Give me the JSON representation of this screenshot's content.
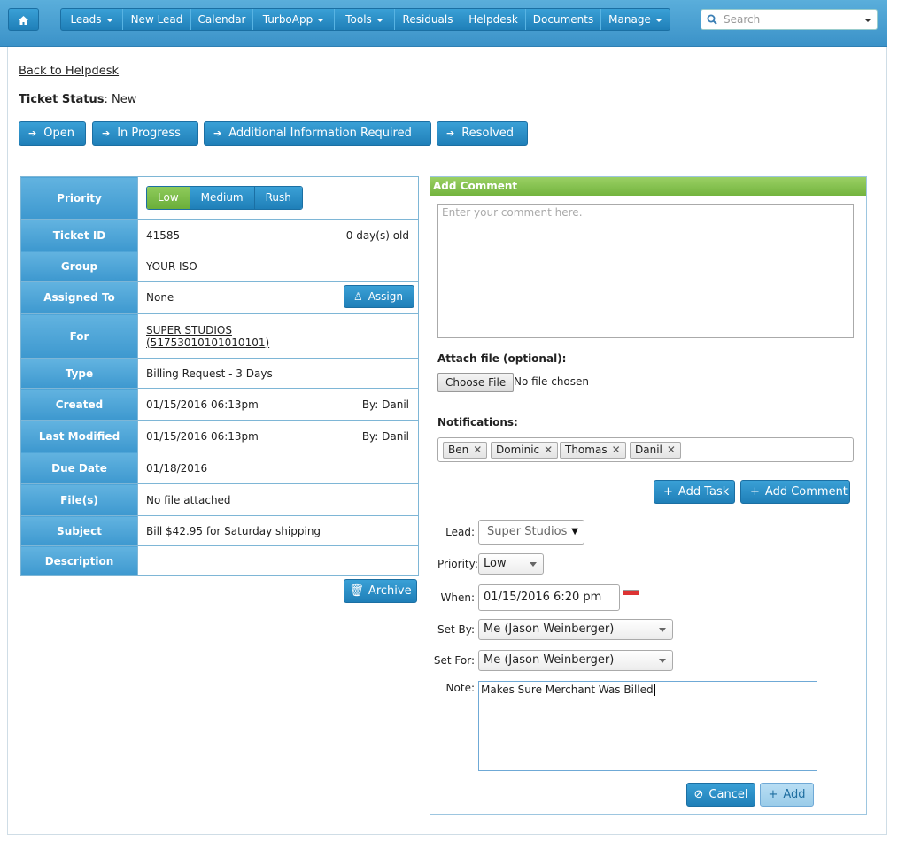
{
  "nav": {
    "home_icon": "home-icon",
    "items": [
      {
        "label": "Leads",
        "dropdown": true
      },
      {
        "label": "New Lead",
        "dropdown": false
      },
      {
        "label": "Calendar",
        "dropdown": false
      },
      {
        "label": "TurboApp",
        "dropdown": true
      },
      {
        "label": "Tools",
        "dropdown": true
      },
      {
        "label": "Residuals",
        "dropdown": false
      },
      {
        "label": "Helpdesk",
        "dropdown": false
      },
      {
        "label": "Documents",
        "dropdown": false
      },
      {
        "label": "Manage",
        "dropdown": true
      }
    ],
    "search_placeholder": "Search"
  },
  "back_link": "Back to Helpdesk",
  "ticket_status": {
    "label": "Ticket Status",
    "value": "New"
  },
  "status_buttons": [
    "Open",
    "In Progress",
    "Additional Information Required",
    "Resolved"
  ],
  "details": {
    "priority": {
      "label": "Priority",
      "options": [
        "Low",
        "Medium",
        "Rush"
      ],
      "selected": "Low"
    },
    "ticket_id": {
      "label": "Ticket ID",
      "value": "41585",
      "age": "0 day(s) old"
    },
    "group": {
      "label": "Group",
      "value": "YOUR ISO"
    },
    "assigned_to": {
      "label": "Assigned To",
      "value": "None",
      "button": "Assign"
    },
    "for": {
      "label": "For",
      "line1": "SUPER STUDIOS",
      "line2": "(51753010101010101)"
    },
    "type": {
      "label": "Type",
      "value": "Billing Request - 3 Days"
    },
    "created": {
      "label": "Created",
      "value": "01/15/2016 06:13pm",
      "by": "By: Danil"
    },
    "last_modified": {
      "label": "Last Modified",
      "value": "01/15/2016 06:13pm",
      "by": "By: Danil"
    },
    "due_date": {
      "label": "Due Date",
      "value": "01/18/2016"
    },
    "files": {
      "label": "File(s)",
      "value": "No file attached"
    },
    "subject": {
      "label": "Subject",
      "value": "Bill $42.95 for Saturday shipping"
    },
    "description": {
      "label": "Description",
      "value": ""
    }
  },
  "archive_button": "Archive",
  "comment_panel": {
    "title": "Add Comment",
    "comment_placeholder": "Enter your comment here.",
    "attach_label": "Attach file (optional):",
    "choose_file": "Choose File",
    "file_status": "No file chosen",
    "notifications_label": "Notifications:",
    "notify_tags": [
      "Ben",
      "Dominic",
      "Thomas",
      "Danil"
    ],
    "add_task": "Add Task",
    "add_comment": "Add Comment"
  },
  "task_form": {
    "lead": {
      "label": "Lead:",
      "value": "Super Studios"
    },
    "priority": {
      "label": "Priority:",
      "value": "Low"
    },
    "when": {
      "label": "When:",
      "value": "01/15/2016 6:20 pm"
    },
    "set_by": {
      "label": "Set By:",
      "value": "Me (Jason Weinberger)"
    },
    "set_for": {
      "label": "Set For:",
      "value": "Me (Jason Weinberger)"
    },
    "note": {
      "label": "Note:",
      "value": "Makes Sure Merchant Was Billed"
    },
    "cancel": "Cancel",
    "add": "Add"
  },
  "colors": {
    "nav_bar": "#3b92c8",
    "button_blue": "#1f7fb8",
    "active_green": "#6aae3a",
    "panel_head": "#73b43e"
  }
}
